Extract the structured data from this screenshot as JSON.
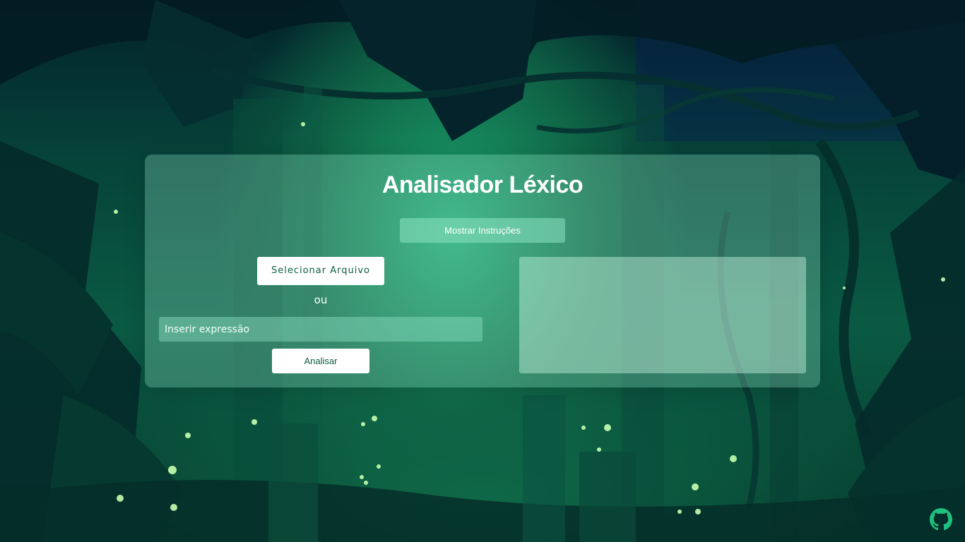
{
  "app": {
    "title": "Analisador Léxico"
  },
  "buttons": {
    "instructions_label": "Mostrar Instruções",
    "select_file_label": "Selecionar Arquivo",
    "analyze_label": "Analisar"
  },
  "separator": {
    "or_text": "ou"
  },
  "expression_input": {
    "value": "",
    "placeholder": "Inserir expressão"
  },
  "output": {
    "content": ""
  },
  "footer": {
    "github_icon": "github-icon"
  },
  "colors": {
    "accent": "#0d5e43",
    "background": "#0a5a43"
  }
}
